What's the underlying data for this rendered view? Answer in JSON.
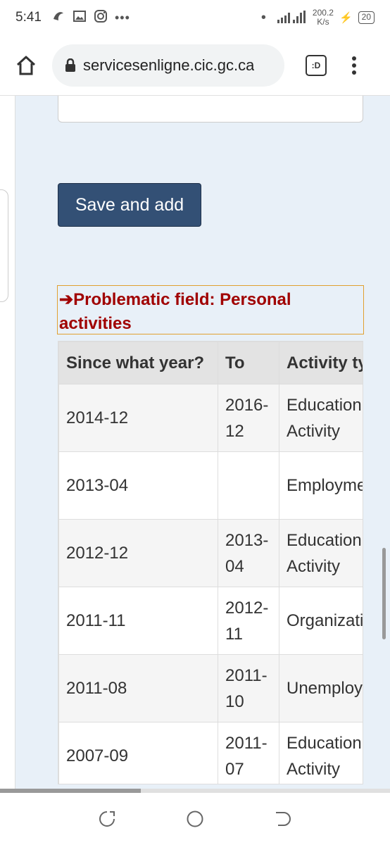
{
  "status_bar": {
    "time": "5:41",
    "speed_value": "200.2",
    "speed_unit": "K/s",
    "battery": "20",
    "more_dots": "•••"
  },
  "browser": {
    "url": "servicesenligne.cic.gc.ca",
    "tab_label": ":D"
  },
  "form": {
    "save_add_label": "Save and add",
    "error_arrow": "➔",
    "error_message": "Problematic field: Personal activities"
  },
  "table": {
    "headers": [
      "Since what year?",
      "To",
      "Activity type"
    ],
    "rows": [
      {
        "since": "2014-12",
        "to": "2016-12",
        "activity": "Education Activity"
      },
      {
        "since": "2013-04",
        "to": "",
        "activity": "Employment"
      },
      {
        "since": "2012-12",
        "to": "2013-04",
        "activity": "Education Activity"
      },
      {
        "since": "2011-11",
        "to": "2012-11",
        "activity": "Organization"
      },
      {
        "since": "2011-08",
        "to": "2011-10",
        "activity": "Unemployed"
      },
      {
        "since": "2007-09",
        "to": "2011-07",
        "activity": "Education Activity"
      }
    ]
  },
  "icons": {
    "home": "home-icon",
    "lock": "lock-icon",
    "menu": "more-vert-icon",
    "nav_recent": "recents-icon",
    "nav_home": "nav-home-icon",
    "nav_back": "back-icon"
  }
}
